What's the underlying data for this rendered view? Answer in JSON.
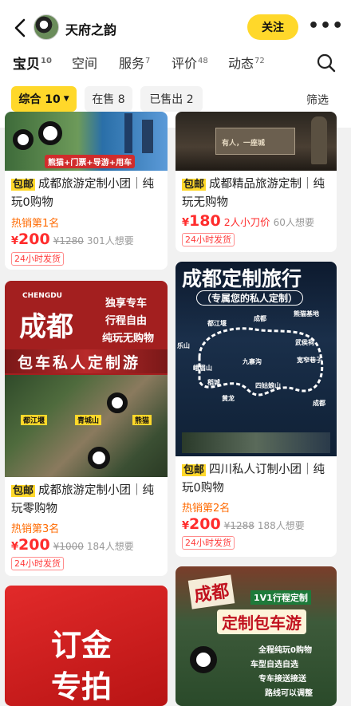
{
  "shop": {
    "name": "天府之韵",
    "follow_label": "关注",
    "more_label": "•••"
  },
  "tabs": [
    {
      "label": "宝贝",
      "count": "10"
    },
    {
      "label": "空间",
      "count": ""
    },
    {
      "label": "服务",
      "count": "7"
    },
    {
      "label": "评价",
      "count": "48"
    },
    {
      "label": "动态",
      "count": "72"
    }
  ],
  "filters": {
    "all_label": "综合 10",
    "on_sale_label": "在售 8",
    "sold_label": "已售出 2",
    "filter_label": "筛选"
  },
  "products": [
    {
      "tag": "包邮",
      "title": "成都旅游定制小团｜纯玩0购物",
      "hot": "热销第1名",
      "currency": "¥",
      "price": "200",
      "orig_price": "¥1280",
      "promo": "",
      "want": "301人想要",
      "ship": "24小时发货",
      "image_banner": "熊猫+门票+导游+用车"
    },
    {
      "tag": "包邮",
      "title": "成都精品旅游定制｜纯玩无购物",
      "hot": "",
      "currency": "¥",
      "price": "180",
      "orig_price": "",
      "promo": "2人小刀价",
      "want": "60人想要",
      "ship": "24小时发货",
      "image_banner": "有人，一座城"
    },
    {
      "tag": "包邮",
      "title": "成都旅游定制小团｜纯玩零购物",
      "hot": "热销第3名",
      "currency": "¥",
      "price": "200",
      "orig_price": "¥1000",
      "promo": "",
      "want": "184人想要",
      "ship": "24小时发货",
      "image": {
        "small": "CHENGDU",
        "city": "成都",
        "lines": [
          "独享专车",
          "行程自由",
          "纯玩无购物"
        ],
        "banner": "包车私人定制游",
        "labels": [
          "都江堰",
          "青城山",
          "熊猫"
        ]
      }
    },
    {
      "tag": "包邮",
      "title": "四川私人订制小团｜纯玩0购物",
      "hot": "热销第2名",
      "currency": "¥",
      "price": "200",
      "orig_price": "¥1288",
      "promo": "",
      "want": "188人想要",
      "ship": "24小时发货",
      "image": {
        "title": "成都定制旅行",
        "subtitle": "（专属您的私人定制）",
        "places": [
          "都江堰",
          "成都",
          "熊猫基地",
          "武侯祠",
          "乐山",
          "宽窄巷子",
          "峨眉山",
          "九寨沟",
          "四姑娘山",
          "稻城",
          "黄龙",
          "成都"
        ]
      }
    },
    {
      "image": {
        "line1": "订金",
        "line2": "专拍"
      }
    },
    {
      "image": {
        "city": "成都",
        "badge": "1V1行程定制",
        "banner": "定制包车游",
        "bullets": [
          "全程纯玩0购物",
          "车型自选自选",
          "专车接送接送",
          "路线可以调整"
        ]
      }
    }
  ],
  "colors": {
    "accent": "#ffd82a",
    "price": "#ff2d2d",
    "hot": "#ff6a00"
  }
}
